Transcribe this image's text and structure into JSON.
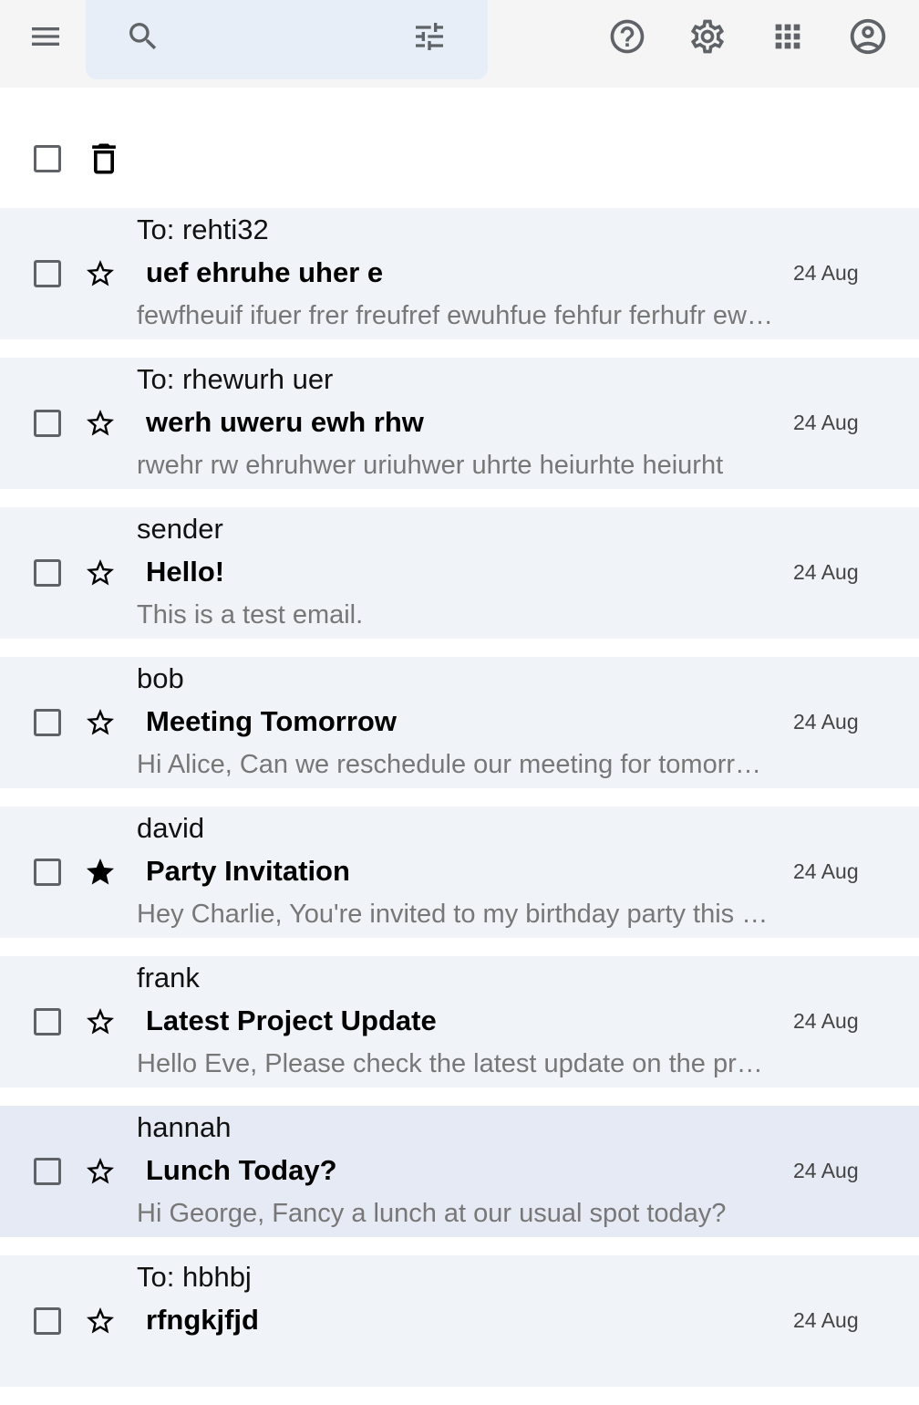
{
  "header": {
    "menu_icon": "menu-icon",
    "search": {
      "icon": "search-icon",
      "placeholder": "",
      "filter_icon": "tune-icon"
    },
    "help_icon": "help-icon",
    "settings_icon": "gear-icon",
    "apps_icon": "apps-grid-icon",
    "account_icon": "account-circle-icon"
  },
  "toolbar": {
    "select_all_icon": "checkbox-icon",
    "delete_icon": "trash-icon"
  },
  "emails": [
    {
      "sender": "To: rehti32",
      "subject": "uef ehruhe uher e",
      "snippet": "fewfheuif ifuer frer freufref ewuhfue fehfur ferhufr ewuhfe",
      "date": "24 Aug",
      "starred": false
    },
    {
      "sender": "To: rhewurh uer",
      "subject": "werh uweru ewh rhw",
      "snippet": "rwehr rw ehruhwer uriuhwer uhrte heiurhte heiurht",
      "date": "24 Aug",
      "starred": false
    },
    {
      "sender": "sender",
      "subject": "Hello!",
      "snippet": "This is a test email.",
      "date": "24 Aug",
      "starred": false
    },
    {
      "sender": "bob",
      "subject": "Meeting Tomorrow",
      "snippet": "Hi Alice, Can we reschedule our meeting for tomorrow?",
      "date": "24 Aug",
      "starred": false
    },
    {
      "sender": "david",
      "subject": "Party Invitation",
      "snippet": "Hey Charlie, You're invited to my birthday party this weekend!",
      "date": "24 Aug",
      "starred": true
    },
    {
      "sender": "frank",
      "subject": "Latest Project Update",
      "snippet": "Hello Eve, Please check the latest update on the project.",
      "date": "24 Aug",
      "starred": false
    },
    {
      "sender": "hannah",
      "subject": "Lunch Today?",
      "snippet": "Hi George, Fancy a lunch at our usual spot today?",
      "date": "24 Aug",
      "starred": false
    },
    {
      "sender": "To: hbhbj",
      "subject": "rfngkjfjd",
      "snippet": "",
      "date": "24 Aug",
      "starred": false
    }
  ],
  "colors": {
    "topbar_bg": "#f5f5f5",
    "search_bg": "#e8eef7",
    "row_bg": "#f0f4f9",
    "row_hover_bg": "#e6eaf5",
    "icon": "#5f6368"
  }
}
